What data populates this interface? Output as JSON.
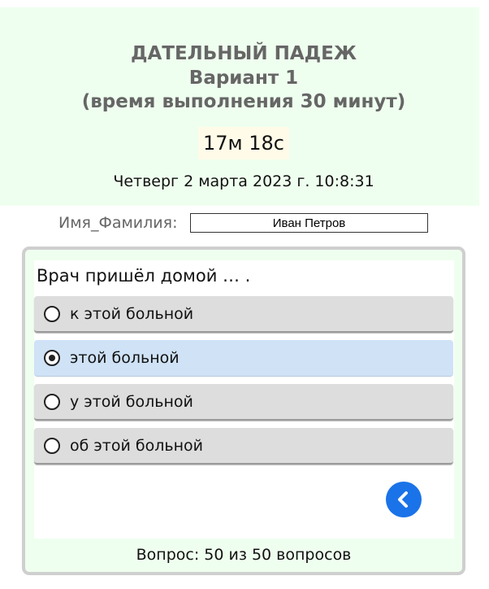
{
  "header": {
    "title": "ДАТЕЛЬНЫЙ ПАДЕЖ",
    "variant": "Вариант 1",
    "duration": "(время выполнения 30 минут)",
    "timer": "17м 18с",
    "datetime": "Четверг 2 марта 2023 г. 10:8:31"
  },
  "name_field": {
    "label": "Имя_Фамилия:",
    "value": "Иван Петров"
  },
  "quiz": {
    "question": "Врач пришёл домой … .",
    "options": [
      {
        "label": "к этой больной",
        "selected": false
      },
      {
        "label": "этой больной",
        "selected": true
      },
      {
        "label": "у этой больной",
        "selected": false
      },
      {
        "label": "об этой больной",
        "selected": false
      }
    ],
    "back_icon": "chevron-left-icon",
    "counter": "Вопрос: 50 из 50 вопросов"
  },
  "colors": {
    "header_bg": "#efffef",
    "selected_option_bg": "#cfe2f6",
    "option_bg": "#dddddd",
    "accent": "#1a73e8",
    "title_text": "#666666"
  }
}
